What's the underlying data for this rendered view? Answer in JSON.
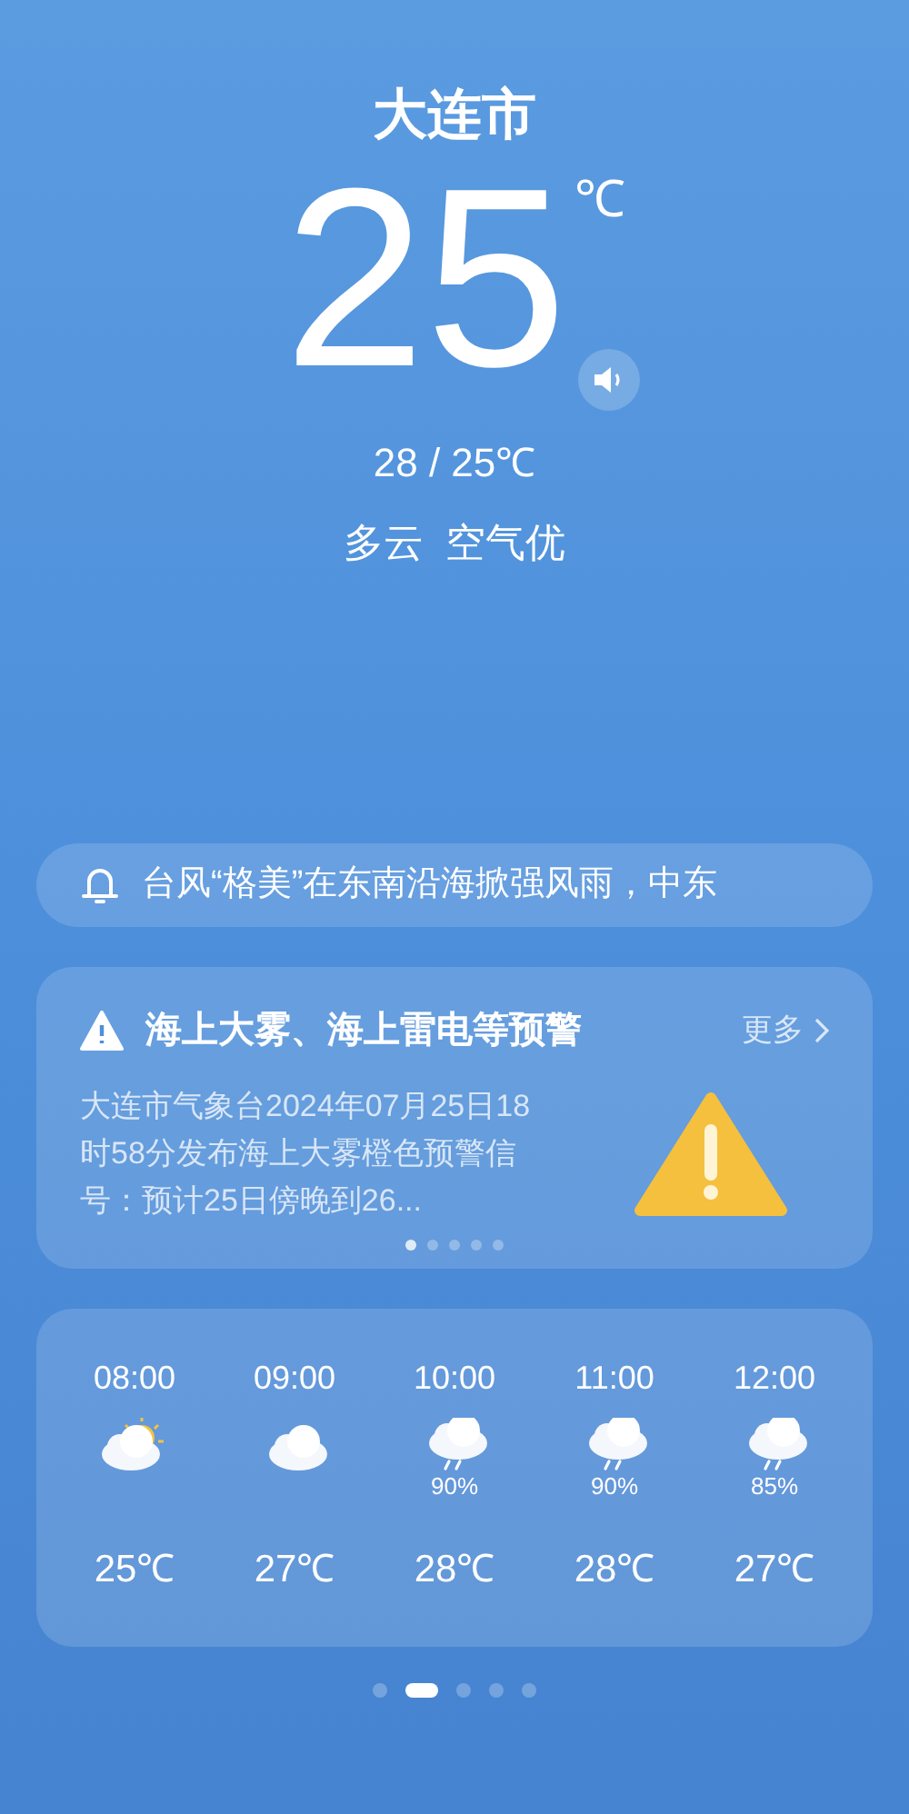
{
  "city": "大连市",
  "temperature": "25",
  "unit": "℃",
  "range": "28 / 25℃",
  "condition": "多云  空气优",
  "alert": {
    "text": "台风“格美”在东南沿海掀强风雨，中东"
  },
  "warning": {
    "title": "海上大雾、海上雷电等预警",
    "more": "更多",
    "body": "大连市气象台2024年07月25日18时58分发布海上大雾橙色预警信号：预计25日傍晚到26...",
    "dots": [
      {
        "selected": true
      },
      {
        "selected": false
      },
      {
        "selected": false
      },
      {
        "selected": false
      },
      {
        "selected": false
      }
    ]
  },
  "hourly": [
    {
      "time": "08:00",
      "kind": "partly-cloudy",
      "temp": "25℃"
    },
    {
      "time": "09:00",
      "kind": "cloudy",
      "temp": "27℃"
    },
    {
      "time": "10:00",
      "kind": "rain",
      "precip": "90%",
      "temp": "28℃"
    },
    {
      "time": "11:00",
      "kind": "rain",
      "precip": "90%",
      "temp": "28℃"
    },
    {
      "time": "12:00",
      "kind": "rain",
      "precip": "85%",
      "temp": "27℃"
    }
  ],
  "pages": [
    {
      "selected": false
    },
    {
      "selected": true
    },
    {
      "selected": false
    },
    {
      "selected": false
    },
    {
      "selected": false
    }
  ]
}
